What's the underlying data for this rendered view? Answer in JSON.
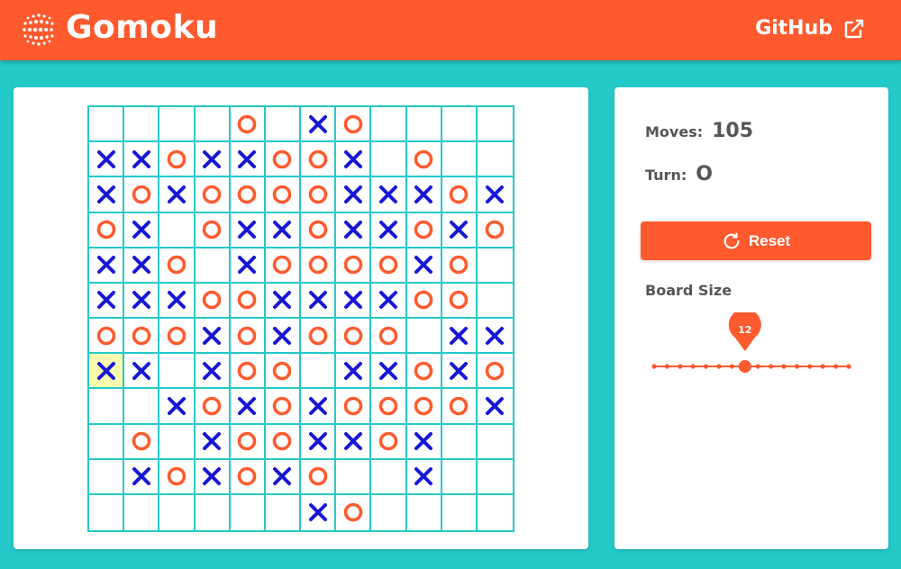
{
  "app": {
    "title": "Gomoku",
    "github_label": "GitHub",
    "accent_color": "#ff5a2e",
    "background_color": "#24c9c9",
    "x_color": "#1616d6",
    "o_color": "#ff5a2e",
    "highlight_color": "#fbfbb0"
  },
  "status": {
    "moves_label": "Moves:",
    "moves_value": "105",
    "turn_label": "Turn:",
    "turn_value": "O"
  },
  "controls": {
    "reset_label": "Reset",
    "board_size_label": "Board Size",
    "board_size_value": "12",
    "board_size_min": 5,
    "board_size_max": 20
  },
  "board": {
    "size": 12,
    "last_move": [
      7,
      0
    ],
    "rows": [
      "....O.XO....",
      "XXOXXOOX.O..",
      "XOXOOOOXXXOX",
      "OX.OXXOXXOXO",
      "XXO.XOOOOXO.",
      "XXXOOXXXXOO.",
      "OOOXOXOOO.XX",
      "XX.XOO.XXOXO",
      "..XOXOXOOOOX",
      ".O.XOOXXOX..",
      ".XOXOXO..X..",
      "......XO...."
    ]
  }
}
